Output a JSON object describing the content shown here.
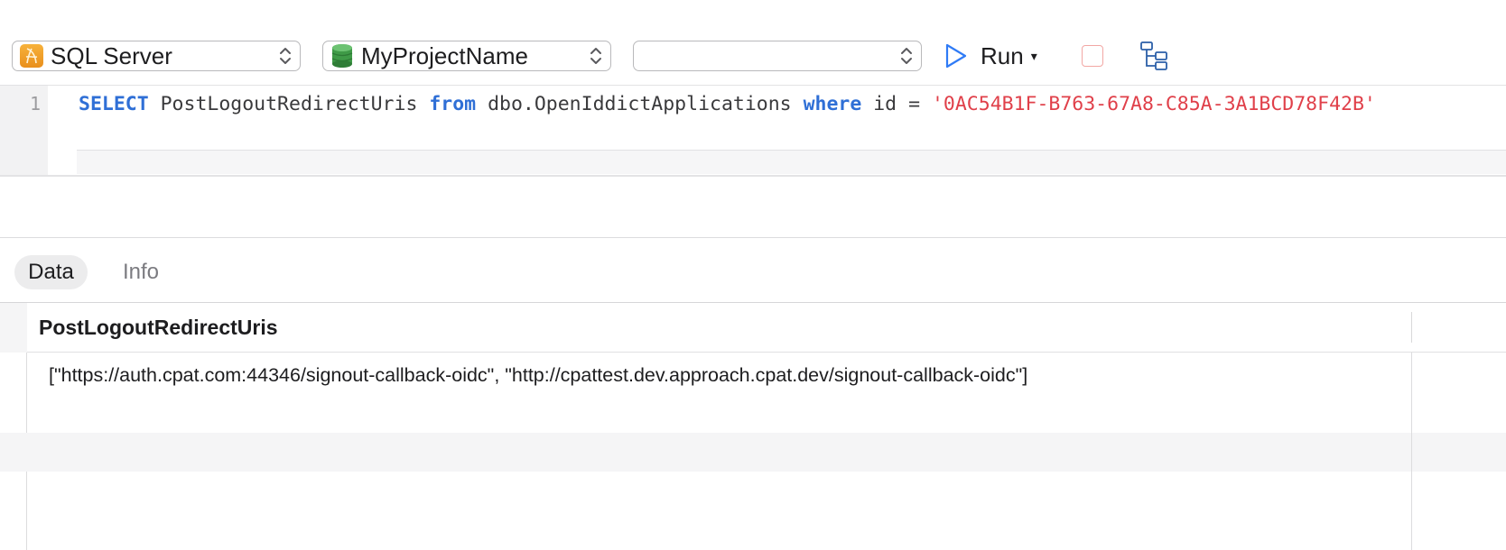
{
  "toolbar": {
    "engine_label": "SQL Server",
    "database_label": "MyProjectName",
    "schema_label": "",
    "run_label": "Run",
    "run_caret": "▾"
  },
  "editor": {
    "line_number": "1",
    "tokens": {
      "select": "SELECT",
      "column": " PostLogoutRedirectUris ",
      "from": "from",
      "table": " dbo.OpenIddictApplications ",
      "where": "where",
      "condition": " id = ",
      "value": "'0AC54B1F-B763-67A8-C85A-3A1BCD78F42B'"
    }
  },
  "results": {
    "tabs": [
      {
        "label": "Data"
      },
      {
        "label": "Info"
      }
    ],
    "columns": [
      "PostLogoutRedirectUris"
    ],
    "rows": [
      [
        "[\"https://auth.cpat.com:44346/signout-callback-oidc\", \"http://cpattest.dev.approach.cpat.dev/signout-callback-oidc\"]"
      ]
    ]
  },
  "colors": {
    "keyword": "#2f6fd6",
    "string": "#e0404a",
    "run_icon": "#2f7bf6",
    "stop_icon": "#f2a7a4"
  }
}
